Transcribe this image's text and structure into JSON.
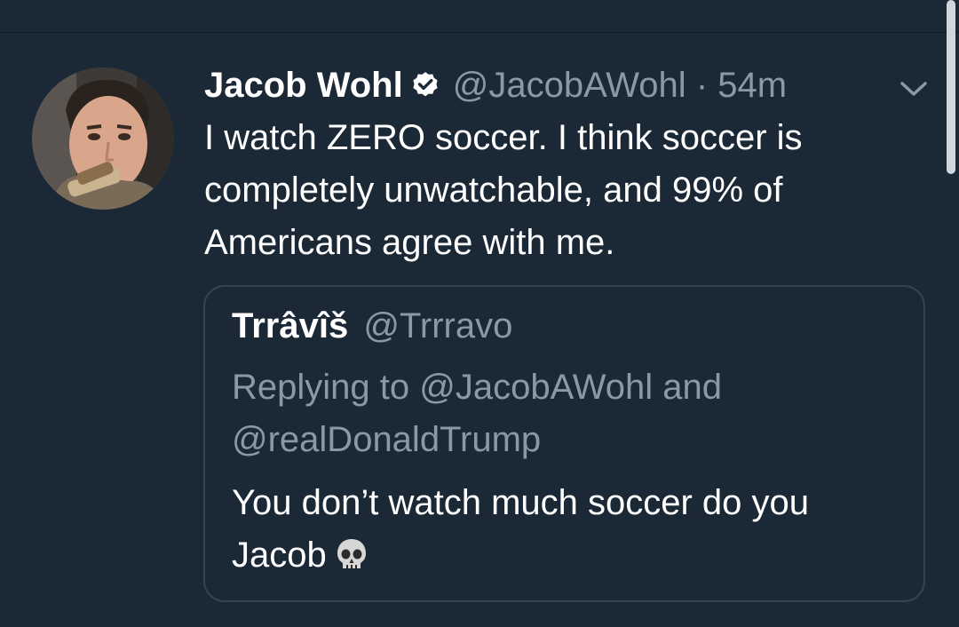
{
  "tweet": {
    "display_name": "Jacob Wohl",
    "verified_icon": "verified-badge-icon",
    "handle": "@JacobAWohl",
    "separator": "·",
    "time": "54m",
    "text": "I watch ZERO soccer. I think soccer is completely unwatchable, and 99% of Americans agree with me.",
    "menu_icon": "chevron-down-icon"
  },
  "quote": {
    "display_name": "Trrâvîš",
    "handle": "@Trrravo",
    "reply_to": "Replying to @JacobAWohl and @realDonaldTrump",
    "text": "You don’t watch much soccer do you Jacob",
    "emoji_icon": "skull-emoji-icon"
  },
  "colors": {
    "background": "#1b2836",
    "primary_text": "#ffffff",
    "secondary_text": "#8b98a5",
    "border": "#38444d"
  }
}
